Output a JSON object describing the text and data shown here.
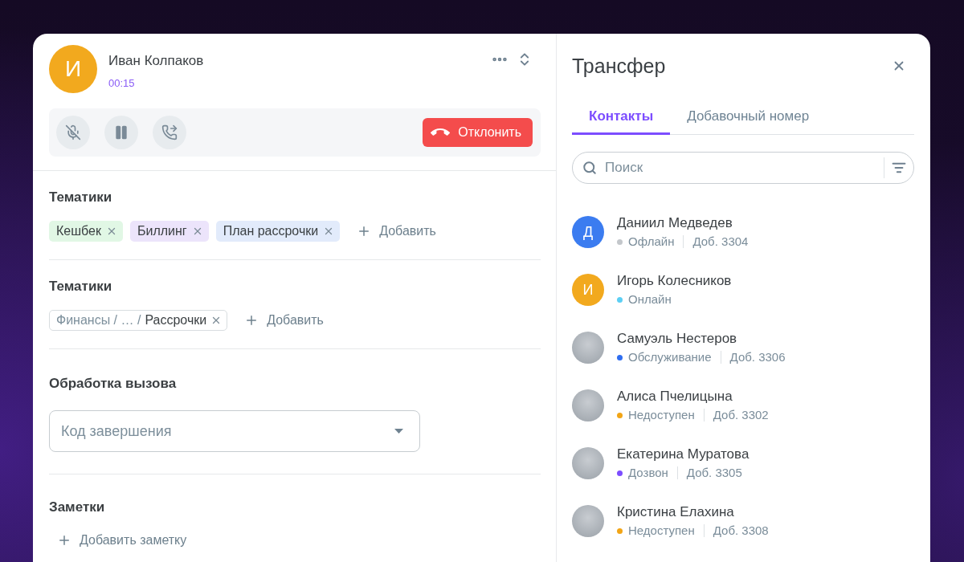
{
  "call": {
    "caller": {
      "initial": "И",
      "name": "Иван Колпаков"
    },
    "duration": "00:15",
    "decline_label": "Отклонить"
  },
  "sections": [
    {
      "kind": "tags",
      "title": "Тематики",
      "tags": [
        {
          "label": "Кешбек",
          "color": "#e1f7e5"
        },
        {
          "label": "Биллинг",
          "color": "#ece4fb"
        },
        {
          "label": "План рассрочки",
          "color": "#e2ebfb"
        }
      ],
      "add_label": "Добавить"
    },
    {
      "kind": "path_tags",
      "title": "Тематики",
      "tags": [
        {
          "path": "Финансы / … /",
          "label": "Рассрочки"
        }
      ],
      "add_label": "Добавить"
    },
    {
      "kind": "select",
      "title": "Обработка вызова",
      "placeholder": "Код завершения"
    },
    {
      "kind": "notes",
      "title": "Заметки",
      "add_label": "Добавить заметку"
    }
  ],
  "transfer": {
    "title": "Трансфер",
    "tabs": [
      {
        "label": "Контакты",
        "selected": true
      },
      {
        "label": "Добавочный номер",
        "selected": false
      }
    ],
    "search": {
      "placeholder": "Поиск"
    },
    "contacts": [
      {
        "name": "Даниил Медведев",
        "avatar": {
          "kind": "initial",
          "letter": "Д",
          "color": "#3b7cf0"
        },
        "status": {
          "label": "Офлайн",
          "color": "#c3c7cb"
        },
        "extension": "Доб. 3304"
      },
      {
        "name": "Игорь Колесников",
        "avatar": {
          "kind": "initial",
          "letter": "И",
          "color": "#f2a91e"
        },
        "status": {
          "label": "Онлайн",
          "color": "#5ccff4"
        }
      },
      {
        "name": "Самуэль Нестеров",
        "avatar": {
          "kind": "photo"
        },
        "status": {
          "label": "Обслуживание",
          "color": "#2f6ef0"
        },
        "extension": "Доб. 3306"
      },
      {
        "name": "Алиса Пчелицына",
        "avatar": {
          "kind": "photo"
        },
        "status": {
          "label": "Недоступен",
          "color": "#f2a516"
        },
        "extension": "Доб. 3302"
      },
      {
        "name": "Екатерина Муратова",
        "avatar": {
          "kind": "photo"
        },
        "status": {
          "label": "Дозвон",
          "color": "#7c4dff"
        },
        "extension": "Доб. 3305"
      },
      {
        "name": "Кристина Елахина",
        "avatar": {
          "kind": "photo"
        },
        "status": {
          "label": "Недоступен",
          "color": "#f2a516"
        },
        "extension": "Доб. 3308"
      }
    ]
  }
}
